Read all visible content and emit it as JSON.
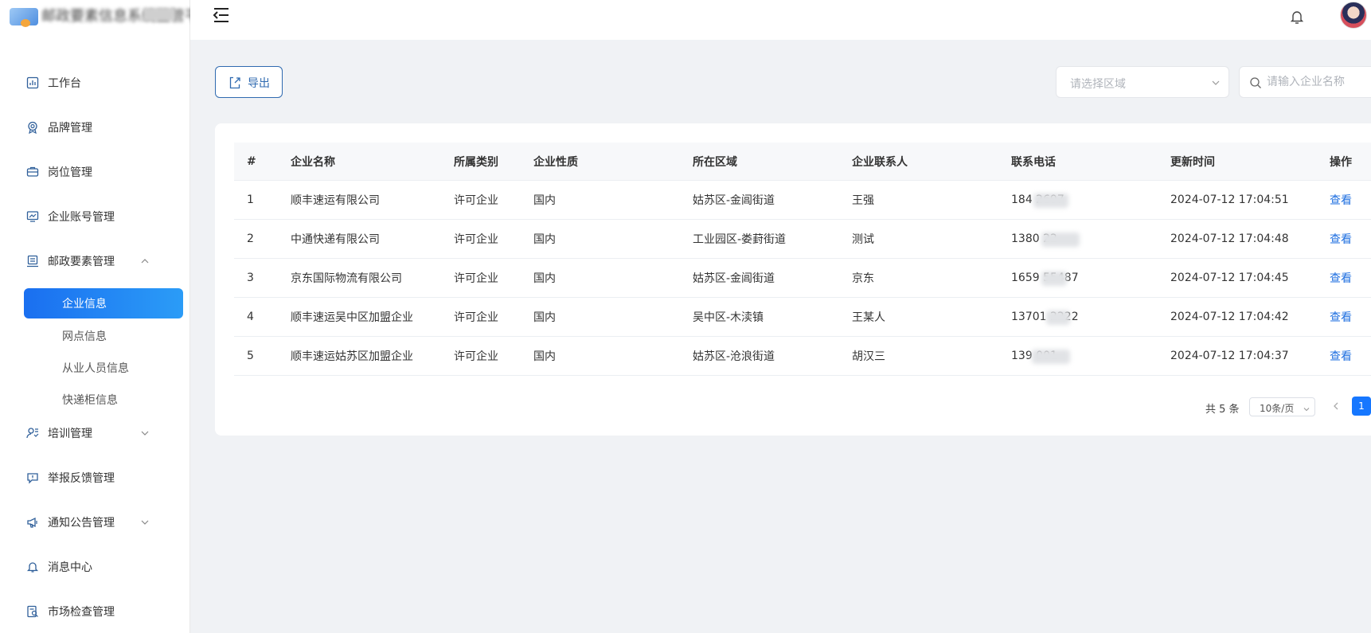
{
  "app": {
    "title": "邮政要素信息系统监管平台"
  },
  "sidebar": {
    "items": [
      {
        "label": "工作台",
        "icon": "dashboard-icon"
      },
      {
        "label": "品牌管理",
        "icon": "award-icon"
      },
      {
        "label": "岗位管理",
        "icon": "briefcase-icon"
      },
      {
        "label": "企业账号管理",
        "icon": "monitor-chart-icon"
      },
      {
        "label": "邮政要素管理",
        "icon": "building-icon",
        "expanded": true
      },
      {
        "label": "培训管理",
        "icon": "user-training-icon"
      },
      {
        "label": "举报反馈管理",
        "icon": "feedback-icon"
      },
      {
        "label": "通知公告管理",
        "icon": "megaphone-icon"
      },
      {
        "label": "消息中心",
        "icon": "bell-icon"
      },
      {
        "label": "市场检查管理",
        "icon": "inspection-icon"
      }
    ],
    "subitems": [
      {
        "label": "企业信息",
        "active": true
      },
      {
        "label": "网点信息"
      },
      {
        "label": "从业人员信息"
      },
      {
        "label": "快递柜信息"
      }
    ]
  },
  "toolbar": {
    "export_label": "导出",
    "region_placeholder": "请选择区域",
    "search_placeholder": "请输入企业名称"
  },
  "table": {
    "columns": [
      "#",
      "企业名称",
      "所属类别",
      "企业性质",
      "所在区域",
      "企业联系人",
      "联系电话",
      "更新时间",
      "操作"
    ],
    "rows": [
      {
        "no": "1",
        "name": "顺丰速运有限公司",
        "category": "许可企业",
        "nature": "国内",
        "region": "姑苏区-金阊街道",
        "contact": "王强",
        "phone": "184 2697",
        "updated": "2024-07-12 17:04:51",
        "action": "查看"
      },
      {
        "no": "2",
        "name": "中通快递有限公司",
        "category": "许可企业",
        "nature": "国内",
        "region": "工业园区-娄葑街道",
        "contact": "测试",
        "phone": "1380 22",
        "updated": "2024-07-12 17:04:48",
        "action": "查看"
      },
      {
        "no": "3",
        "name": "京东国际物流有限公司",
        "category": "许可企业",
        "nature": "国内",
        "region": "姑苏区-金阊街道",
        "contact": "京东",
        "phone": "1659 55487",
        "updated": "2024-07-12 17:04:45",
        "action": "查看"
      },
      {
        "no": "4",
        "name": "顺丰速运吴中区加盟企业",
        "category": "许可企业",
        "nature": "国内",
        "region": "吴中区-木渎镇",
        "contact": "王某人",
        "phone": "13701 2222",
        "updated": "2024-07-12 17:04:42",
        "action": "查看"
      },
      {
        "no": "5",
        "name": "顺丰速运姑苏区加盟企业",
        "category": "许可企业",
        "nature": "国内",
        "region": "姑苏区-沧浪街道",
        "contact": "胡汉三",
        "phone": "139 001",
        "updated": "2024-07-12 17:04:37",
        "action": "查看"
      }
    ]
  },
  "pagination": {
    "total_text": "共 5 条",
    "page_size": "10条/页",
    "current_page": "1"
  },
  "colors": {
    "accent": "#1677ff",
    "active_menu_start": "#1a6ff0",
    "active_menu_end": "#2b9cf7",
    "export_border": "#2f6ab0"
  }
}
